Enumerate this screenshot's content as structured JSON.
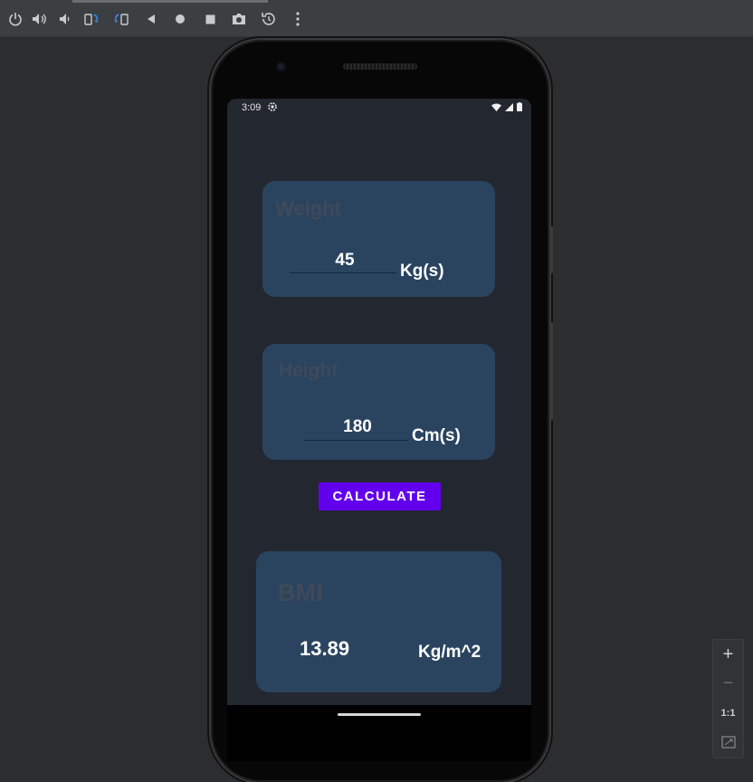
{
  "toolbar": {
    "icons": [
      "power-icon",
      "volume-up-icon",
      "volume-down-icon",
      "rotate-left-icon",
      "rotate-right-icon",
      "back-icon",
      "home-icon",
      "overview-icon",
      "screenshot-icon",
      "snapshot-icon",
      "more-icon"
    ]
  },
  "status_bar": {
    "time": "3:09"
  },
  "weight_card": {
    "title": "Weight",
    "value": "45",
    "unit": "Kg(s)"
  },
  "height_card": {
    "title": "Height",
    "value": "180",
    "unit": "Cm(s)"
  },
  "calculate_button": {
    "label": "CALCULATE"
  },
  "bmi_card": {
    "title": "BMI",
    "value": "13.89",
    "unit": "Kg/m^2"
  },
  "zoom_controls": {
    "zoom_in": "+",
    "zoom_out": "−",
    "actual_size": "1:1"
  },
  "colors": {
    "accent": "#6200ee",
    "card": "#2a4460",
    "screen_bg": "#232730",
    "card_title": "#3f4a59"
  }
}
